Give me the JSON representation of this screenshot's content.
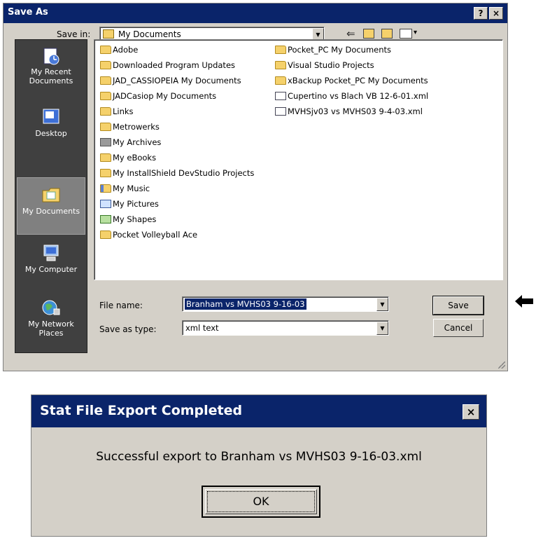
{
  "save_as": {
    "title": "Save As",
    "help_btn": "?",
    "close_btn": "×",
    "save_in_label": "Save in:",
    "save_in_value": "My Documents",
    "places": [
      {
        "label": "My Recent Documents",
        "icon": "recent-documents-icon"
      },
      {
        "label": "Desktop",
        "icon": "desktop-icon"
      },
      {
        "label": "My Documents",
        "icon": "my-documents-icon"
      },
      {
        "label": "My Computer",
        "icon": "my-computer-icon"
      },
      {
        "label": "My Network Places",
        "icon": "network-places-icon"
      }
    ],
    "files_col1": [
      {
        "name": "Adobe",
        "icon": "folder-icon"
      },
      {
        "name": "Downloaded Program Updates",
        "icon": "folder-icon"
      },
      {
        "name": "JAD_CASSIOPEIA My Documents",
        "icon": "folder-icon"
      },
      {
        "name": "JADCasiop My Documents",
        "icon": "folder-icon"
      },
      {
        "name": "Links",
        "icon": "folder-icon"
      },
      {
        "name": "Metrowerks",
        "icon": "folder-icon"
      },
      {
        "name": "My Archives",
        "icon": "archives-icon"
      },
      {
        "name": "My eBooks",
        "icon": "folder-icon"
      },
      {
        "name": "My InstallShield DevStudio Projects",
        "icon": "folder-icon"
      },
      {
        "name": "My Music",
        "icon": "music-folder-icon"
      },
      {
        "name": "My Pictures",
        "icon": "pictures-folder-icon"
      },
      {
        "name": "My Shapes",
        "icon": "shapes-folder-icon"
      },
      {
        "name": "Pocket Volleyball Ace",
        "icon": "folder-icon"
      }
    ],
    "files_col2": [
      {
        "name": "Pocket_PC My Documents",
        "icon": "folder-icon"
      },
      {
        "name": "Visual Studio Projects",
        "icon": "folder-icon"
      },
      {
        "name": "xBackup Pocket_PC My Documents",
        "icon": "folder-icon"
      },
      {
        "name": "Cupertino vs Blach VB 12-6-01.xml",
        "icon": "xml-file-icon"
      },
      {
        "name": "MVHSjv03 vs MVHS03 9-4-03.xml",
        "icon": "xml-file-icon"
      }
    ],
    "file_name_label": "File name:",
    "file_name_value": "Branham vs MVHS03 9-16-03",
    "save_as_type_label": "Save as type:",
    "save_as_type_value": "xml text",
    "save_button": "Save",
    "cancel_button": "Cancel"
  },
  "export_dialog": {
    "title": "Stat File Export Completed",
    "close_btn": "×",
    "message": "Successful export to Branham vs MVHS03 9-16-03.xml",
    "ok_button": "OK"
  },
  "colors": {
    "titlebar": "#0a246a",
    "dialog_face": "#d4d0c8",
    "places_bar": "#404040"
  }
}
